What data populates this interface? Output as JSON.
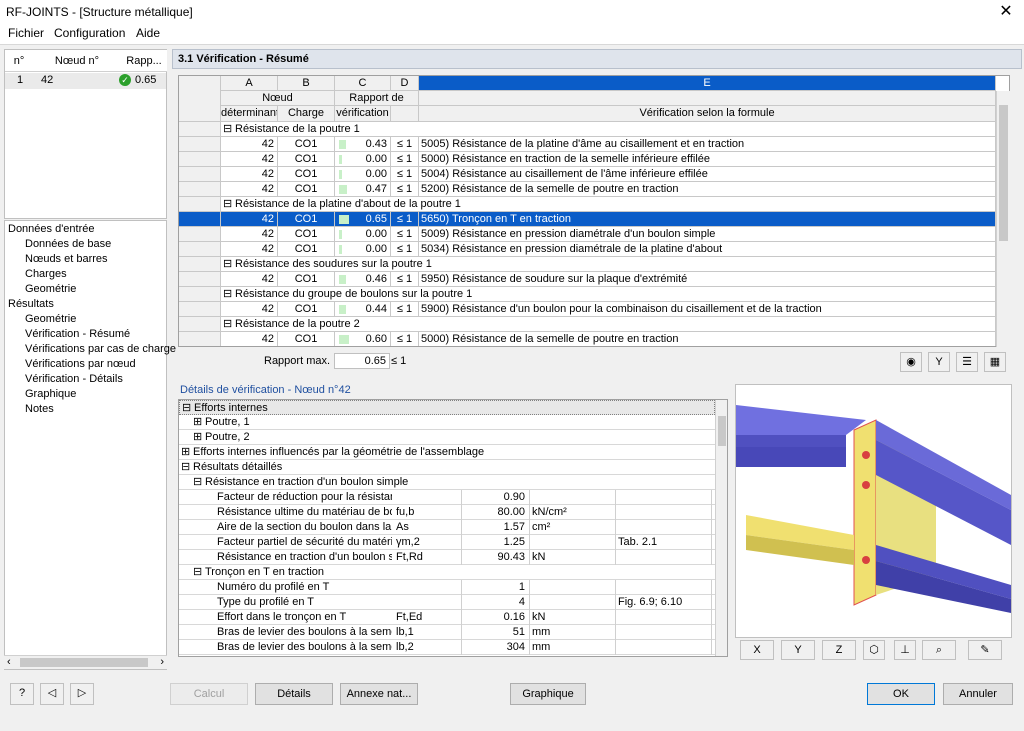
{
  "window": {
    "title": "RF-JOINTS - [Structure métallique]",
    "close": "✕"
  },
  "menu": [
    "Fichier",
    "Configuration",
    "Aide"
  ],
  "nodes": {
    "headers": [
      "n°",
      "Nœud n°",
      "Rapp..."
    ],
    "rows": [
      {
        "n": "1",
        "node": "42",
        "ratio": "0.65"
      }
    ]
  },
  "nav": {
    "g1": "Données d'entrée",
    "g1_items": [
      "Données de base",
      "Nœuds et barres",
      "Charges",
      "Geométrie"
    ],
    "g2": "Résultats",
    "g2_items": [
      "Geométrie",
      "Vérification - Résumé",
      "Vérifications par cas de charge",
      "Vérifications par nœud",
      "Vérification - Détails",
      "Graphique",
      "Notes"
    ]
  },
  "panel": {
    "title": "3.1 Vérification - Résumé"
  },
  "grid": {
    "cols": [
      "A",
      "B",
      "C",
      "D",
      "E"
    ],
    "sub1": [
      "Nœud",
      "",
      "Rapport de",
      ""
    ],
    "sub2": [
      "déterminant",
      "Charge",
      "vérification",
      "",
      "Vérification selon la formule"
    ],
    "rows": [
      {
        "type": "group",
        "text": "Résistance de la poutre 1"
      },
      {
        "node": "42",
        "load": "CO1",
        "ratio": "0.43",
        "bar": 0.43,
        "le": "≤ 1",
        "desc": "5005) Résistance de la platine d'âme au cisaillement et en traction"
      },
      {
        "node": "42",
        "load": "CO1",
        "ratio": "0.00",
        "bar": 0,
        "le": "≤ 1",
        "desc": "5000) Résistance en traction de la semelle inférieure effilée"
      },
      {
        "node": "42",
        "load": "CO1",
        "ratio": "0.00",
        "bar": 0,
        "le": "≤ 1",
        "desc": "5004) Résistance au cisaillement de l'âme inférieure effilée"
      },
      {
        "node": "42",
        "load": "CO1",
        "ratio": "0.47",
        "bar": 0.47,
        "le": "≤ 1",
        "desc": "5200) Résistance de la semelle de poutre en traction"
      },
      {
        "type": "group",
        "text": "Résistance de la platine d'about de la poutre 1"
      },
      {
        "node": "42",
        "load": "CO1",
        "ratio": "0.65",
        "bar": 0.65,
        "le": "≤ 1",
        "desc": "5650) Tronçon en T en traction",
        "sel": true
      },
      {
        "node": "42",
        "load": "CO1",
        "ratio": "0.00",
        "bar": 0,
        "le": "≤ 1",
        "desc": "5009) Résistance en pression diamétrale d'un boulon simple"
      },
      {
        "node": "42",
        "load": "CO1",
        "ratio": "0.00",
        "bar": 0,
        "le": "≤ 1",
        "desc": "5034) Résistance en pression diamétrale de la platine d'about"
      },
      {
        "type": "group",
        "text": "Résistance des soudures sur la poutre 1"
      },
      {
        "node": "42",
        "load": "CO1",
        "ratio": "0.46",
        "bar": 0.46,
        "le": "≤ 1",
        "desc": "5950) Résistance de soudure sur la plaque d'extrémité"
      },
      {
        "type": "group",
        "text": "Résistance du groupe de boulons sur la poutre 1"
      },
      {
        "node": "42",
        "load": "CO1",
        "ratio": "0.44",
        "bar": 0.44,
        "le": "≤ 1",
        "desc": "5900) Résistance d'un boulon pour la combinaison du cisaillement et de la traction"
      },
      {
        "type": "group",
        "text": "Résistance de la poutre 2"
      },
      {
        "node": "42",
        "load": "CO1",
        "ratio": "0.60",
        "bar": 0.6,
        "le": "≤ 1",
        "desc": "5000) Résistance de la semelle de poutre en traction"
      }
    ]
  },
  "maxrow": {
    "label": "Rapport max. :",
    "value": "0.65",
    "le": "≤ 1"
  },
  "details": {
    "title": "Détails de vérification - Nœud n°42",
    "rows": [
      {
        "lvl": 0,
        "exp": "⊟",
        "text": "Efforts internes",
        "hl": true
      },
      {
        "lvl": 1,
        "exp": "⊞",
        "text": "Poutre, 1"
      },
      {
        "lvl": 1,
        "exp": "⊞",
        "text": "Poutre, 2"
      },
      {
        "lvl": 0,
        "exp": "⊞",
        "text": "Efforts internes influencés par la géométrie de l'assemblage"
      },
      {
        "lvl": 0,
        "exp": "⊟",
        "text": "Résultats détaillés"
      },
      {
        "lvl": 1,
        "exp": "⊟",
        "text": "Résistance en traction d'un boulon simple"
      },
      {
        "lvl": 2,
        "text": "Facteur de réduction pour la résistance",
        "sym": "",
        "val": "0.90",
        "unit": "",
        "ref": ""
      },
      {
        "lvl": 2,
        "text": "Résistance ultime du matériau de boulon",
        "sym": "fu,b",
        "val": "80.00",
        "unit": "kN/cm²",
        "ref": ""
      },
      {
        "lvl": 2,
        "text": "Aire de la section du boulon dans la partie filetée",
        "sym": "As",
        "val": "1.57",
        "unit": "cm²",
        "ref": ""
      },
      {
        "lvl": 2,
        "text": "Facteur partiel de sécurité du matériau",
        "sym": "γm,2",
        "val": "1.25",
        "unit": "",
        "ref": "Tab. 2.1"
      },
      {
        "lvl": 2,
        "text": "Résistance en traction d'un boulon simple",
        "sym": "Ft,Rd",
        "val": "90.43",
        "unit": "kN",
        "ref": ""
      },
      {
        "lvl": 1,
        "exp": "⊟",
        "text": "Tronçon en T en traction"
      },
      {
        "lvl": 2,
        "text": "Numéro du profilé en T",
        "sym": "",
        "val": "1",
        "unit": "",
        "ref": ""
      },
      {
        "lvl": 2,
        "text": "Type du profilé en T",
        "sym": "",
        "val": "4",
        "unit": "",
        "ref": "Fig. 6.9; 6.10"
      },
      {
        "lvl": 2,
        "text": "Effort dans le tronçon en T",
        "sym": "Ft,Ed",
        "val": "0.16",
        "unit": "kN",
        "ref": ""
      },
      {
        "lvl": 2,
        "text": "Bras de levier des boulons à la semelle supérieure",
        "sym": "lb,1",
        "val": "51",
        "unit": "mm",
        "ref": ""
      },
      {
        "lvl": 2,
        "text": "Bras de levier des boulons à la semelle inférieure",
        "sym": "lb,2",
        "val": "304",
        "unit": "mm",
        "ref": ""
      }
    ]
  },
  "buttons": {
    "calc": "Calcul",
    "details": "Détails",
    "annex": "Annexe nat...",
    "graph": "Graphique",
    "ok": "OK",
    "cancel": "Annuler"
  },
  "toolbar3d": [
    "X",
    "Y",
    "Z"
  ],
  "colors": {
    "selection": "#0a5cc8",
    "beam": "#5a5ad8",
    "plate": "#f0e070",
    "ok_green": "#2ca02c"
  }
}
